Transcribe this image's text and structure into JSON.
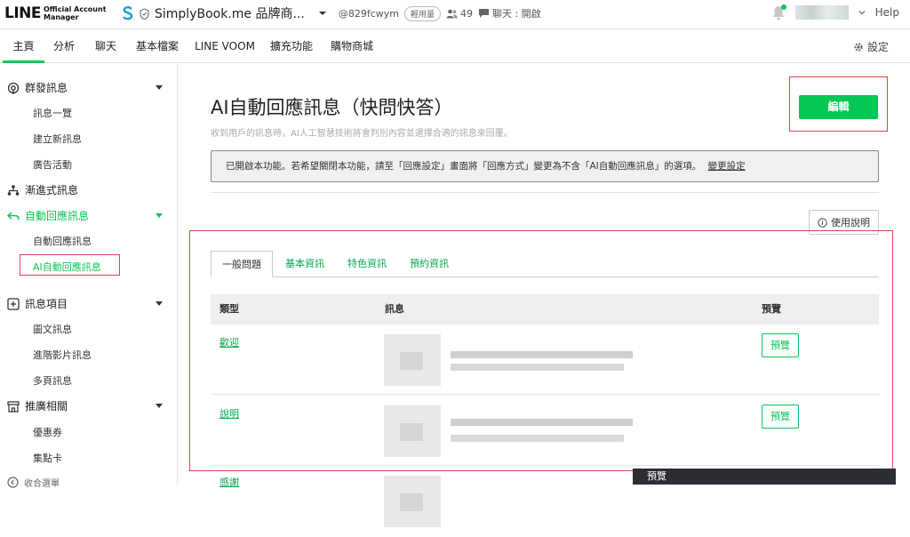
{
  "header": {
    "logo_main": "LINE",
    "logo_sub_1": "Official Account",
    "logo_sub_2": "Manager",
    "account_name": "SimplyBook.me 品牌商...",
    "account_id": "@829fcwym",
    "plan_badge": "輕用量",
    "friends_count": "49",
    "chat_status": "聊天 : 開啟",
    "help_label": "Help"
  },
  "nav": {
    "tabs": [
      {
        "label": "主頁",
        "active": true
      },
      {
        "label": "分析",
        "active": false
      },
      {
        "label": "聊天",
        "active": false
      },
      {
        "label": "基本檔案",
        "active": false
      },
      {
        "label": "LINE VOOM",
        "active": false
      },
      {
        "label": "擴充功能",
        "active": false
      },
      {
        "label": "購物商城",
        "active": false
      }
    ],
    "settings_label": "設定"
  },
  "sidebar": {
    "sec_broadcast": "群發訊息",
    "item_list": "訊息一覽",
    "item_create": "建立新訊息",
    "item_ads": "廣告活動",
    "sec_step": "漸進式訊息",
    "sec_auto": "自動回應訊息",
    "item_auto": "自動回應訊息",
    "item_ai": "AI自動回應訊息",
    "sec_items": "訊息項目",
    "item_rich": "圖文訊息",
    "item_video": "進階影片訊息",
    "item_multi": "多頁訊息",
    "sec_promo": "推廣相關",
    "item_coupon": "優惠券",
    "item_card": "集點卡",
    "sec_more": "收合選單"
  },
  "main": {
    "title": "AI自動回應訊息（快問快答）",
    "subtitle": "收到用戶的訊息時，AI人工智慧技術將會判別內容並選擇合適的訊息來回覆。",
    "edit_button": "編輯",
    "notice_text": "已開啟本功能。若希望關閉本功能，請至「回應設定」畫面將「回應方式」變更為不含「AI自動回應訊息」的選項。",
    "notice_link": "變更設定",
    "help_button": "使用說明",
    "subtabs": [
      "一般問題",
      "基本資訊",
      "特色資訊",
      "預約資訊"
    ],
    "table_headers": {
      "type": "類型",
      "message": "訊息",
      "preview": "預覽"
    },
    "rows": [
      {
        "type": "歡迎",
        "preview": "預覽"
      },
      {
        "type": "說明",
        "preview": "預覽"
      },
      {
        "type": "感謝"
      }
    ],
    "dark_panel_label": "預覽"
  },
  "colors": {
    "accent": "#06c755",
    "highlight": "#e0434c"
  }
}
